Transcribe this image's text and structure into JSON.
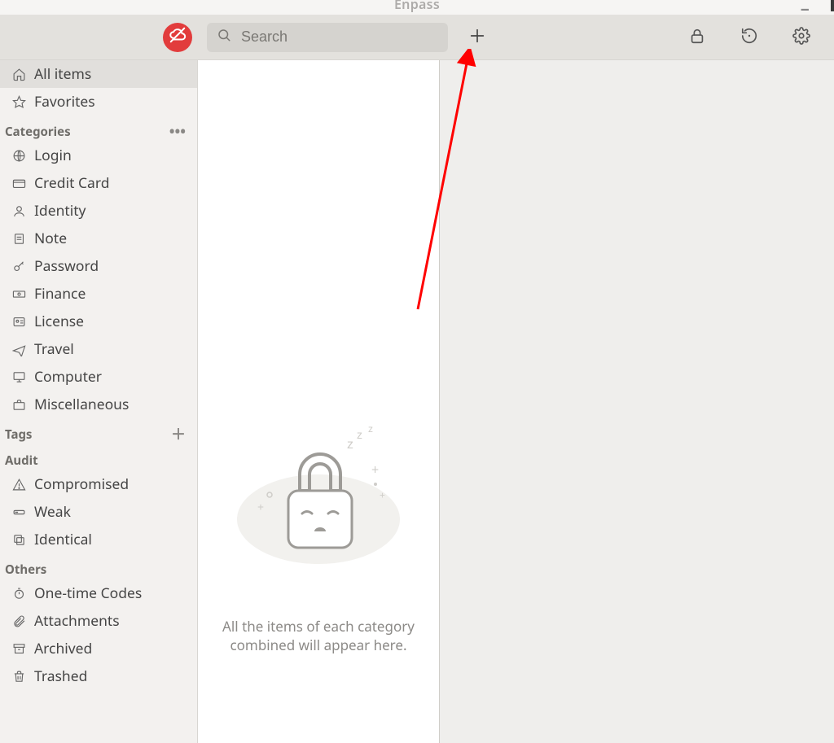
{
  "titlebar": {
    "title": "Enpass"
  },
  "toolbar": {
    "search_placeholder": "Search"
  },
  "sidebar": {
    "top": [
      {
        "label": "All items"
      },
      {
        "label": "Favorites"
      }
    ],
    "sections": {
      "categories": {
        "title": "Categories",
        "items": [
          {
            "label": "Login"
          },
          {
            "label": "Credit Card"
          },
          {
            "label": "Identity"
          },
          {
            "label": "Note"
          },
          {
            "label": "Password"
          },
          {
            "label": "Finance"
          },
          {
            "label": "License"
          },
          {
            "label": "Travel"
          },
          {
            "label": "Computer"
          },
          {
            "label": "Miscellaneous"
          }
        ]
      },
      "tags": {
        "title": "Tags"
      },
      "audit": {
        "title": "Audit",
        "items": [
          {
            "label": "Compromised"
          },
          {
            "label": "Weak"
          },
          {
            "label": "Identical"
          }
        ]
      },
      "others": {
        "title": "Others",
        "items": [
          {
            "label": "One-time Codes"
          },
          {
            "label": "Attachments"
          },
          {
            "label": "Archived"
          },
          {
            "label": "Trashed"
          }
        ]
      }
    }
  },
  "list": {
    "empty_line1": "All the items of each category",
    "empty_line2": "combined will appear here."
  }
}
